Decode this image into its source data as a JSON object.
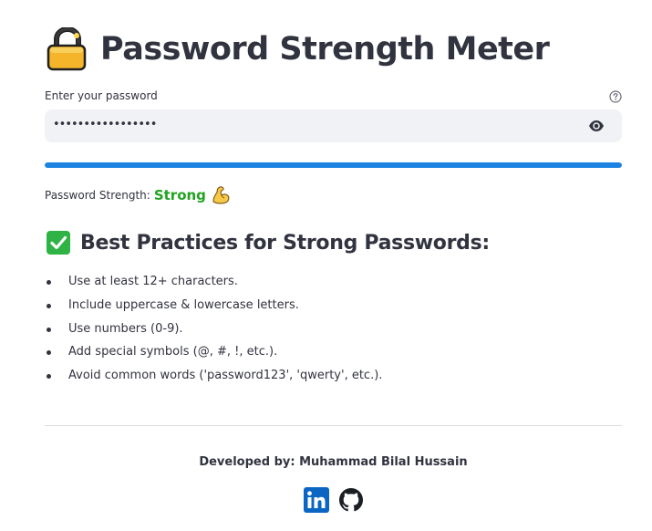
{
  "header": {
    "title": "Password Strength Meter",
    "icon": "locked-padlock-icon"
  },
  "password_field": {
    "label": "Enter your password",
    "masked_value": "•••••••••••••••••",
    "help_icon": "question-circle-icon",
    "toggle_icon": "eye-icon"
  },
  "strength": {
    "label": "Password Strength:",
    "value": "Strong",
    "emoji": "flexed-biceps-icon",
    "progress_fraction": 1.0,
    "bar_color": "#1c83e1",
    "value_color": "#21a321"
  },
  "best_practices": {
    "icon": "check-mark-button-icon",
    "heading": "Best Practices for Strong Passwords:",
    "items": [
      "Use at least 12+ characters.",
      "Include uppercase & lowercase letters.",
      "Use numbers (0-9).",
      "Add special symbols (@, #, !, etc.).",
      "Avoid common words ('password123', 'qwerty', etc.)."
    ]
  },
  "footer": {
    "developed_by": "Developed by: Muhammad Bilal Hussain",
    "links": [
      {
        "icon": "linkedin-icon"
      },
      {
        "icon": "github-icon"
      }
    ]
  }
}
